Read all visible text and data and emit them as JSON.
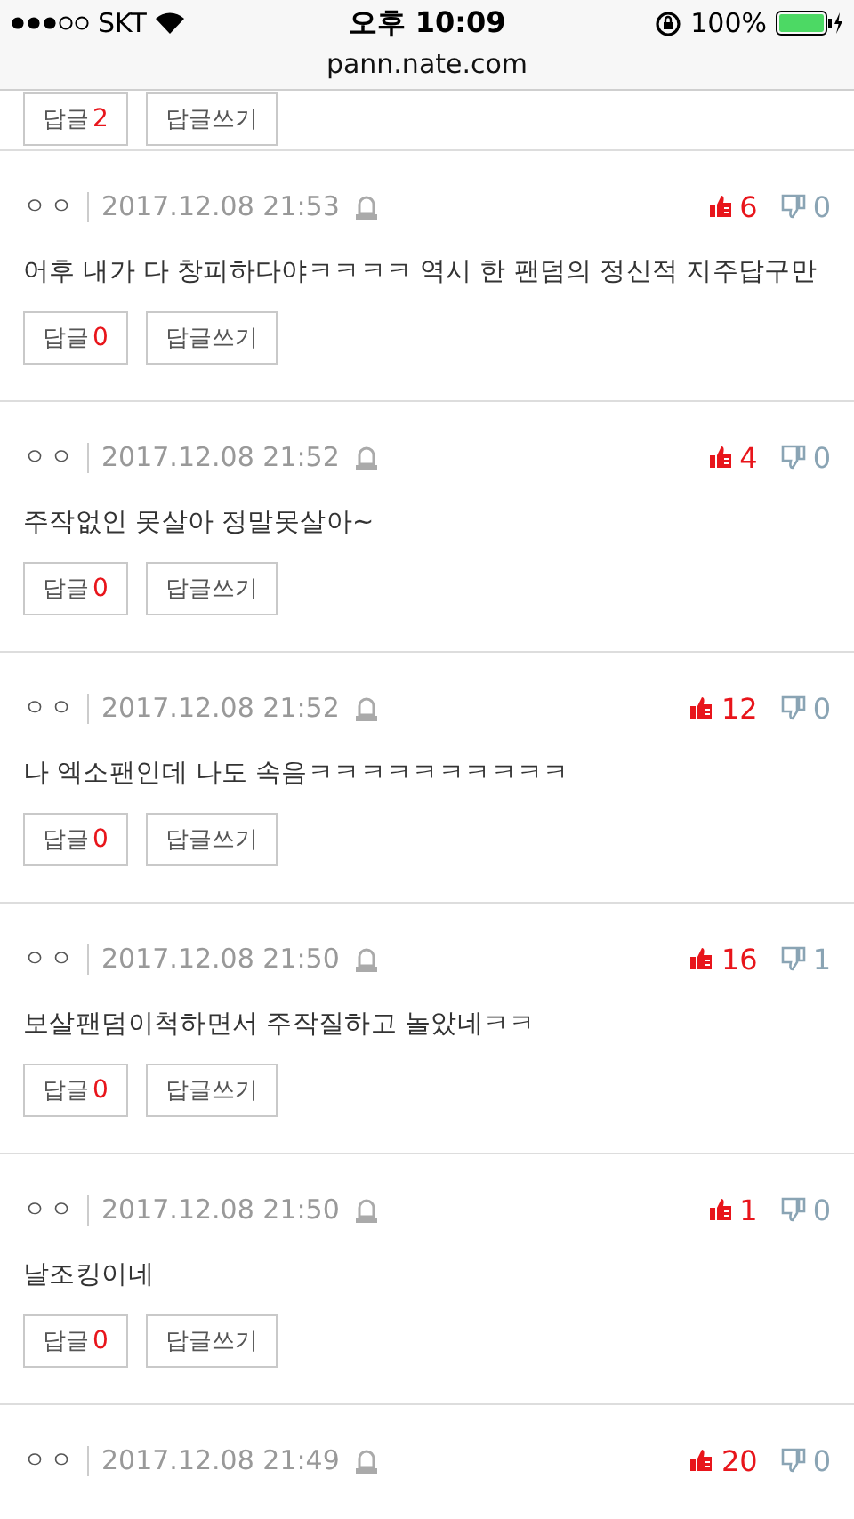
{
  "status_bar": {
    "carrier": "SKT",
    "time": "오후 10:09",
    "battery": "100%"
  },
  "address_bar": {
    "url": "pann.nate.com"
  },
  "partial_comment": {
    "reply_label": "답글",
    "reply_count": "2",
    "write_label": "답글쓰기"
  },
  "comments": [
    {
      "author": "ㅇㅇ",
      "date": "2017.12.08 21:53",
      "likes": "6",
      "dislikes": "0",
      "text": "어후 내가 다 창피하다야ㅋㅋㅋㅋ 역시 한 팬덤의 정신적 지주답구만",
      "reply_label": "답글",
      "reply_count": "0",
      "write_label": "답글쓰기"
    },
    {
      "author": "ㅇㅇ",
      "date": "2017.12.08 21:52",
      "likes": "4",
      "dislikes": "0",
      "text": "주작없인 못살아 정말못살아~",
      "reply_label": "답글",
      "reply_count": "0",
      "write_label": "답글쓰기"
    },
    {
      "author": "ㅇㅇ",
      "date": "2017.12.08 21:52",
      "likes": "12",
      "dislikes": "0",
      "text": "나 엑소팬인데 나도 속음ㅋㅋㅋㅋㅋㅋㅋㅋㅋㅋ",
      "reply_label": "답글",
      "reply_count": "0",
      "write_label": "답글쓰기"
    },
    {
      "author": "ㅇㅇ",
      "date": "2017.12.08 21:50",
      "likes": "16",
      "dislikes": "1",
      "text": "보살팬덤이척하면서 주작질하고 놀았네ㅋㅋ",
      "reply_label": "답글",
      "reply_count": "0",
      "write_label": "답글쓰기"
    },
    {
      "author": "ㅇㅇ",
      "date": "2017.12.08 21:50",
      "likes": "1",
      "dislikes": "0",
      "text": "날조킹이네",
      "reply_label": "답글",
      "reply_count": "0",
      "write_label": "답글쓰기"
    },
    {
      "author": "ㅇㅇ",
      "date": "2017.12.08 21:49",
      "likes": "20",
      "dislikes": "0"
    }
  ]
}
